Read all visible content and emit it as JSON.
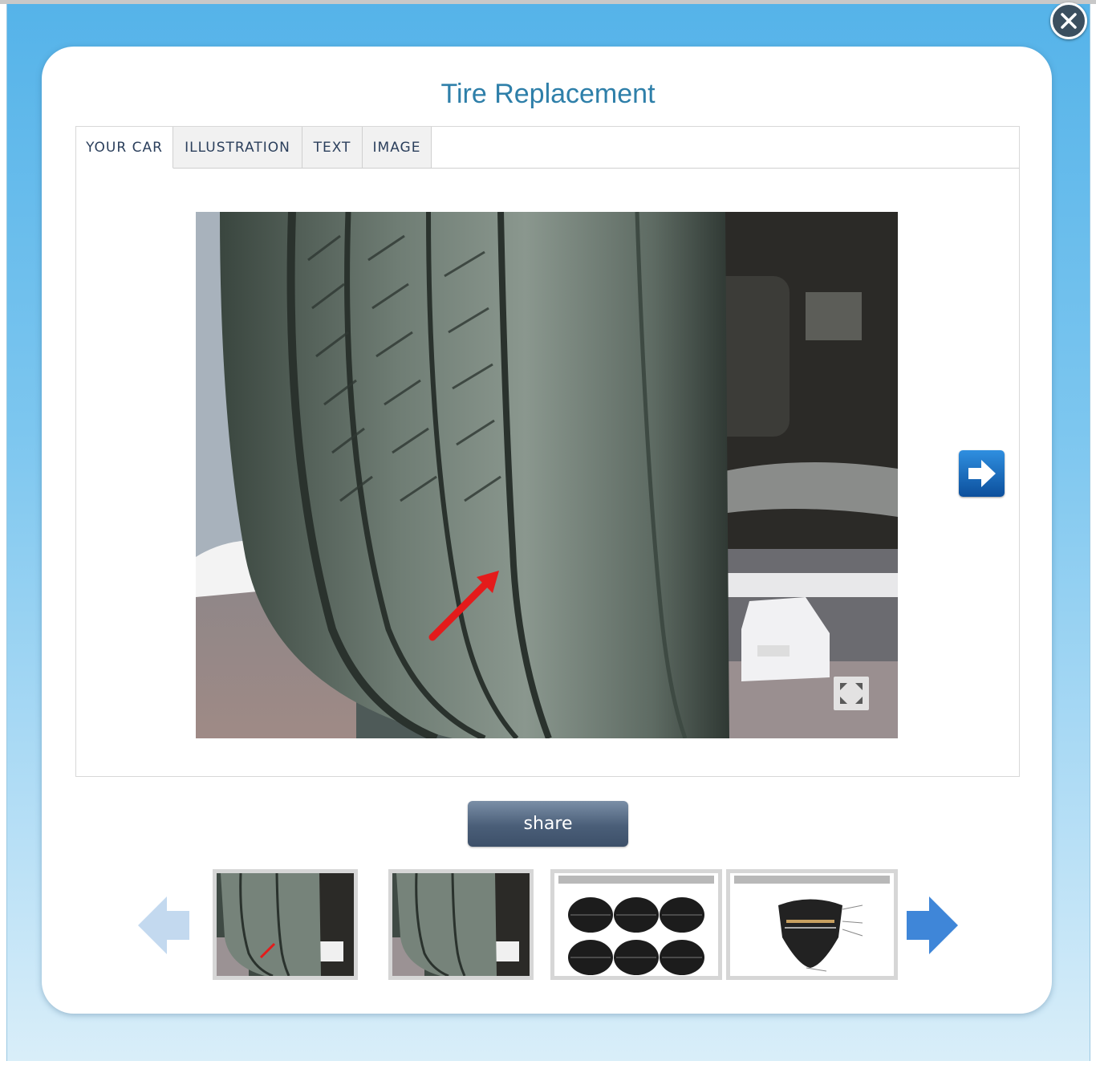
{
  "modal": {
    "title": "Tire Replacement"
  },
  "tabs": [
    {
      "label": "YOUR CAR",
      "active": true
    },
    {
      "label": "ILLUSTRATION",
      "active": false
    },
    {
      "label": "TEXT",
      "active": false
    },
    {
      "label": "IMAGE",
      "active": false
    }
  ],
  "main_image": {
    "icon_overlay": "expand-icon"
  },
  "actions": {
    "share_label": "share"
  },
  "icons": {
    "close": "close-icon",
    "next": "arrow-right-icon",
    "prev": "arrow-left-icon"
  },
  "colors": {
    "accent_title": "#2e7fa9",
    "background_top": "#55b3e9",
    "share_button": "#4a5e78",
    "next_button": "#1d6fc4"
  },
  "thumbnails": [
    {
      "kind": "tire-photo-with-arrow"
    },
    {
      "kind": "tire-photo"
    },
    {
      "kind": "tire-types-diagram"
    },
    {
      "kind": "tire-cutaway-diagram"
    }
  ]
}
